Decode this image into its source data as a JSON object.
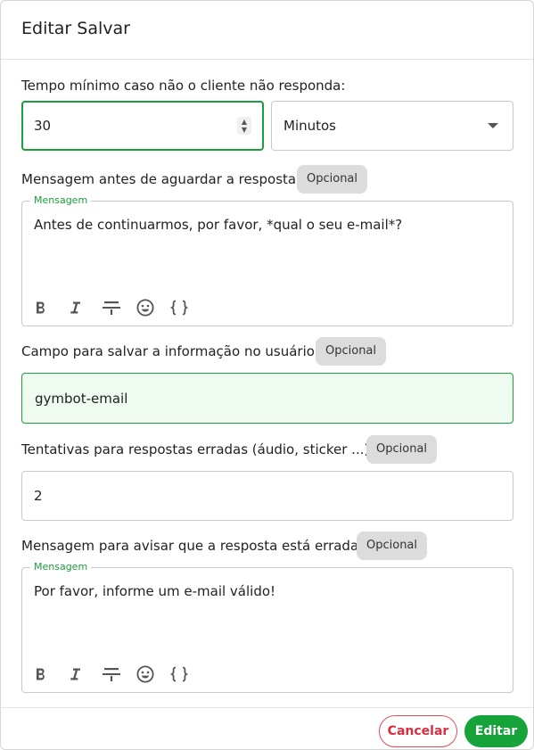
{
  "dialog": {
    "title": "Editar Salvar"
  },
  "timeout": {
    "label": "Tempo mínimo caso não o cliente não responda:",
    "value": "30",
    "unit": "Minutos"
  },
  "before_message": {
    "label": "Mensagem antes de aguardar a resposta:",
    "badge": "Opcional",
    "legend": "Mensagem",
    "text": "Antes de continuarmos, por favor, *qual o seu e-mail*?"
  },
  "save_field": {
    "label": "Campo para salvar a informação no usuário:",
    "badge": "Opcional",
    "value": "gymbot-email"
  },
  "attempts": {
    "label": "Tentativas para respostas erradas (áudio, sticker ...):",
    "badge": "Opcional",
    "value": "2"
  },
  "wrong_message": {
    "label": "Mensagem para avisar que a resposta está errada:",
    "badge": "Opcional",
    "legend": "Mensagem",
    "text": "Por favor, informe um e-mail válido!"
  },
  "toolbar_icons": [
    "bold-icon",
    "italic-icon",
    "strikethrough-icon",
    "emoji-icon",
    "variables-icon"
  ],
  "footer": {
    "cancel_label": "Cancelar",
    "edit_label": "Editar"
  },
  "colors": {
    "accent": "#1b9e3b",
    "danger": "#d92e3f",
    "primary_button": "#15a33a"
  }
}
